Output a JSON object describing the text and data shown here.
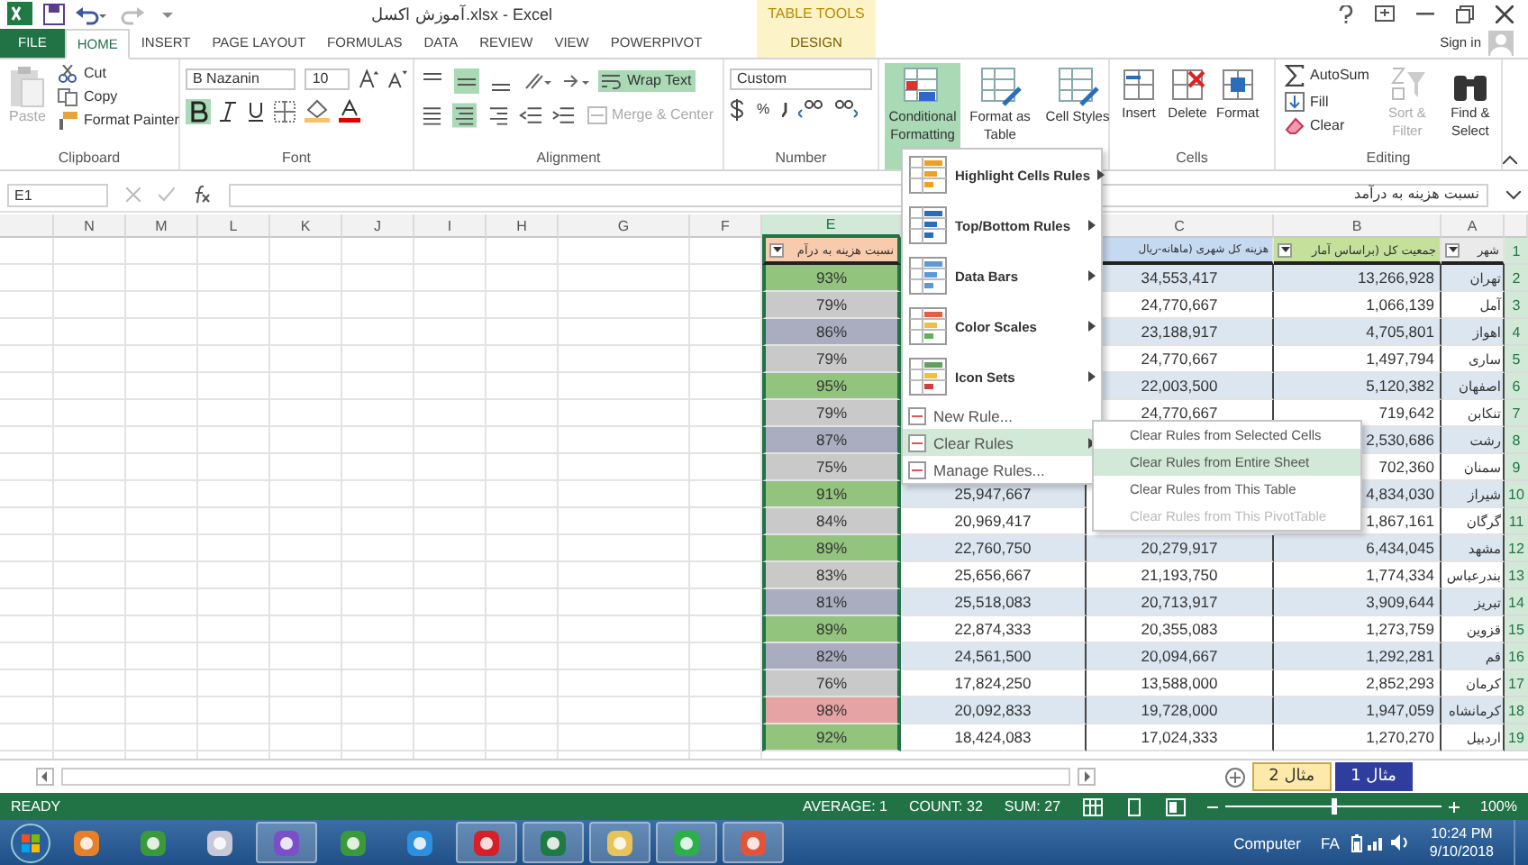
{
  "window": {
    "title": "آموزش اکسل.xlsx - Excel",
    "context_group": "TABLE TOOLS",
    "sign_in": "Sign in"
  },
  "ribbon_tabs": [
    {
      "label": "FILE",
      "kind": "file",
      "selected": false
    },
    {
      "label": "HOME",
      "kind": "tab",
      "selected": true
    },
    {
      "label": "INSERT",
      "kind": "tab",
      "selected": false
    },
    {
      "label": "PAGE LAYOUT",
      "kind": "tab",
      "selected": false
    },
    {
      "label": "FORMULAS",
      "kind": "tab",
      "selected": false
    },
    {
      "label": "DATA",
      "kind": "tab",
      "selected": false
    },
    {
      "label": "REVIEW",
      "kind": "tab",
      "selected": false
    },
    {
      "label": "VIEW",
      "kind": "tab",
      "selected": false
    },
    {
      "label": "POWERPIVOT",
      "kind": "tab",
      "selected": false
    },
    {
      "label": "DESIGN",
      "kind": "context",
      "selected": false
    }
  ],
  "clipboard": {
    "paste": "Paste",
    "cut": "Cut",
    "copy": "Copy",
    "format_painter": "Format Painter",
    "label": "Clipboard"
  },
  "font": {
    "name": "B Nazanin",
    "size": "10",
    "bold": true,
    "label": "Font"
  },
  "alignment": {
    "vertical": [
      {
        "on": false
      },
      {
        "on": true
      },
      {
        "on": false
      }
    ],
    "horizontal": [
      {
        "on": false
      },
      {
        "on": true
      },
      {
        "on": false
      }
    ],
    "wrap_text": "Wrap Text",
    "wrap_on": true,
    "merge": "Merge & Center",
    "label": "Alignment"
  },
  "number": {
    "format": "Custom",
    "percent": "%",
    "label": "Number"
  },
  "styles": [
    {
      "label": "Conditional Formatting",
      "selected": true
    },
    {
      "label": "Format as Table",
      "selected": false
    },
    {
      "label": "Cell Styles",
      "selected": false
    }
  ],
  "cells": {
    "buttons": [
      "Insert",
      "Delete",
      "Format"
    ],
    "label": "Cells"
  },
  "editing": {
    "autosum": "AutoSum",
    "fill": "Fill",
    "clear": "Clear",
    "big": [
      {
        "label": "Sort & Filter",
        "disabled": true
      },
      {
        "label": "Find & Select",
        "disabled": false
      }
    ],
    "label": "Editing"
  },
  "formula_bar": {
    "name_box": "E1",
    "formula": "نسبت هزینه به درآمد"
  },
  "columns": [
    {
      "label": "N",
      "selected": false
    },
    {
      "label": "M",
      "selected": false
    },
    {
      "label": "L",
      "selected": false
    },
    {
      "label": "K",
      "selected": false
    },
    {
      "label": "J",
      "selected": false
    },
    {
      "label": "I",
      "selected": false
    },
    {
      "label": "H",
      "selected": false
    },
    {
      "label": "G",
      "selected": false
    },
    {
      "label": "F",
      "selected": false
    },
    {
      "label": "E",
      "selected": true
    },
    {
      "label": "C",
      "selected": false
    },
    {
      "label": "B",
      "selected": false
    },
    {
      "label": "A",
      "selected": false
    }
  ],
  "table": {
    "header": {
      "num": "1",
      "ratio": "نسبت هزینه به درآم",
      "c": "هزینه کل شهری (ماهانه-ریال",
      "b": "جمعیت کل (براساس آمار",
      "a": "شهر"
    },
    "rows": [
      {
        "num": "2",
        "ratio": "93%",
        "color": "#93c47d",
        "c": "34,553,417",
        "b": "13,266,928",
        "a": "تهران"
      },
      {
        "num": "3",
        "ratio": "79%",
        "color": "#c9c9c9",
        "c": "24,770,667",
        "b": "1,066,139",
        "a": "آمل"
      },
      {
        "num": "4",
        "ratio": "86%",
        "color": "#a9adbf",
        "c": "23,188,917",
        "b": "4,705,801",
        "a": "اهواز"
      },
      {
        "num": "5",
        "ratio": "79%",
        "color": "#c9c9c9",
        "c": "24,770,667",
        "b": "1,497,794",
        "a": "ساری"
      },
      {
        "num": "6",
        "ratio": "95%",
        "color": "#93c47d",
        "c": "22,003,500",
        "b": "5,120,382",
        "a": "اصفهان"
      },
      {
        "num": "7",
        "ratio": "79%",
        "color": "#c9c9c9",
        "c": "24,770,667",
        "b": "719,642",
        "a": "تنکابن"
      },
      {
        "num": "8",
        "ratio": "87%",
        "color": "#a9adbf",
        "b": "2,530,686",
        "a": "رشت"
      },
      {
        "num": "9",
        "ratio": "75%",
        "color": "#c9c9c9",
        "b": "702,360",
        "a": "سمنان"
      },
      {
        "num": "10",
        "ratio": "91%",
        "color": "#93c47d",
        "d": "25,947,667",
        "b": "4,834,030",
        "a": "شیراز"
      },
      {
        "num": "11",
        "ratio": "84%",
        "color": "#c9c9c9",
        "d": "20,969,417",
        "b": "1,867,161",
        "a": "گرگان"
      },
      {
        "num": "12",
        "ratio": "89%",
        "color": "#93c47d",
        "d": "22,760,750",
        "c": "20,279,917",
        "b": "6,434,045",
        "a": "مشهد"
      },
      {
        "num": "13",
        "ratio": "83%",
        "color": "#c9c9c9",
        "d": "25,656,667",
        "c": "21,193,750",
        "b": "1,774,334",
        "a": "بندرعباس"
      },
      {
        "num": "14",
        "ratio": "81%",
        "color": "#a9adbf",
        "d": "25,518,083",
        "c": "20,713,917",
        "b": "3,909,644",
        "a": "تبریز"
      },
      {
        "num": "15",
        "ratio": "89%",
        "color": "#93c47d",
        "d": "22,874,333",
        "c": "20,355,083",
        "b": "1,273,759",
        "a": "قزوین"
      },
      {
        "num": "16",
        "ratio": "82%",
        "color": "#a9adbf",
        "d": "24,561,500",
        "c": "20,094,667",
        "b": "1,292,281",
        "a": "قم"
      },
      {
        "num": "17",
        "ratio": "76%",
        "color": "#c9c9c9",
        "d": "17,824,250",
        "c": "13,588,000",
        "b": "2,852,293",
        "a": "کرمان"
      },
      {
        "num": "18",
        "ratio": "98%",
        "color": "#e6a3a3",
        "d": "20,092,833",
        "c": "19,728,000",
        "b": "1,947,059",
        "a": "کرمانشاه"
      },
      {
        "num": "19",
        "ratio": "92%",
        "color": "#93c47d",
        "d": "18,424,083",
        "c": "17,024,333",
        "b": "1,270,270",
        "a": "اردبیل"
      }
    ]
  },
  "cf_menu": {
    "items": [
      {
        "label": "Highlight Cells Rules",
        "kind": "big",
        "submenu": true,
        "selected": false
      },
      {
        "label": "Top/Bottom Rules",
        "kind": "big",
        "submenu": true,
        "selected": false
      },
      {
        "label": "Data Bars",
        "kind": "big",
        "submenu": true,
        "selected": false
      },
      {
        "label": "Color Scales",
        "kind": "big",
        "submenu": true,
        "selected": false
      },
      {
        "label": "Icon Sets",
        "kind": "big",
        "submenu": true,
        "selected": false
      },
      {
        "label": "New Rule...",
        "kind": "small",
        "submenu": false,
        "selected": false
      },
      {
        "label": "Clear Rules",
        "kind": "small",
        "submenu": true,
        "selected": true
      },
      {
        "label": "Manage Rules...",
        "kind": "small",
        "submenu": false,
        "selected": false
      }
    ],
    "submenu": [
      {
        "label": "Clear Rules from Selected Cells",
        "selected": false,
        "disabled": false
      },
      {
        "label": "Clear Rules from Entire Sheet",
        "selected": true,
        "disabled": false
      },
      {
        "label": "Clear Rules from This Table",
        "selected": false,
        "disabled": false
      },
      {
        "label": "Clear Rules from This PivotTable",
        "selected": false,
        "disabled": true
      }
    ]
  },
  "sheet_tabs": [
    {
      "label": "مثال 1",
      "selected": true
    },
    {
      "label": "مثال 2",
      "selected": false
    }
  ],
  "status_bar": {
    "mode": "READY",
    "average": "AVERAGE: 1",
    "count": "COUNT: 32",
    "sum": "SUM: 27",
    "zoom": "100%",
    "zoom_level": {
      "level": 0.5
    }
  },
  "taskbar": {
    "apps": [
      {
        "kind": "media",
        "open": false
      },
      {
        "kind": "chrome",
        "open": false
      },
      {
        "kind": "paint",
        "open": false
      },
      {
        "kind": "studio",
        "open": true
      },
      {
        "kind": "chrome",
        "open": false
      },
      {
        "kind": "ie",
        "open": false
      },
      {
        "kind": "opera",
        "open": true
      },
      {
        "kind": "excel",
        "open": true
      },
      {
        "kind": "folder",
        "open": true
      },
      {
        "kind": "camtasia",
        "open": true
      },
      {
        "kind": "recorder",
        "open": true
      }
    ],
    "computer": "Computer",
    "language": "FA",
    "time": "10:24 PM",
    "date": "9/10/2018"
  }
}
